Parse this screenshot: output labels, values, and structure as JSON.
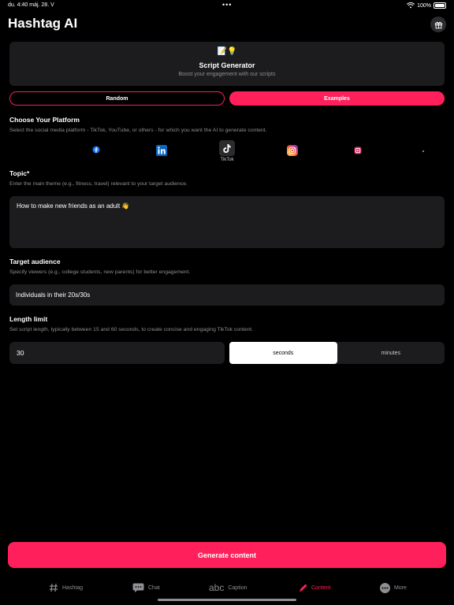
{
  "status_bar": {
    "time_date": "du. 4:40   máj. 28. V",
    "dots": "•••",
    "battery": "100%"
  },
  "app_title": "Hashtag AI",
  "hero": {
    "emoji": "📝💡",
    "title": "Script Generator",
    "subtitle": "Boost your engagement with our scripts"
  },
  "modes": {
    "random": "Random",
    "examples": "Examples"
  },
  "platform_section": {
    "label": "Choose Your Platform",
    "help": "Select the social media platform - TikTok, YouTube, or others - for which you want the AI to generate content.",
    "items": [
      {
        "icon": "facebook-icon",
        "label": ""
      },
      {
        "icon": "linkedin-icon",
        "label": ""
      },
      {
        "icon": "tiktok-icon",
        "label": "TikTok",
        "selected": true
      },
      {
        "icon": "instagram-icon",
        "label": ""
      },
      {
        "icon": "instagram-reels-icon",
        "label": ""
      },
      {
        "icon": "more-platform-icon",
        "label": ""
      }
    ]
  },
  "topic": {
    "label": "Topic*",
    "help": "Enter the main theme (e.g., fitness, travel) relevant to your target audience.",
    "value": "How to make new friends as an adult 👋"
  },
  "audience": {
    "label": "Target audience",
    "help": "Specify viewers (e.g., college students, new parents) for better engagement.",
    "value": "Individuals in their 20s/30s"
  },
  "length": {
    "label": "Length limit",
    "help": "Set script length, typically between 15 and 60 seconds, to create concise and engaging TikTok content.",
    "value": "30",
    "unit_seconds": "seconds",
    "unit_minutes": "minutes",
    "selected_unit": "seconds"
  },
  "generate_label": "Generate content",
  "tabs": {
    "hashtag": "Hashtag",
    "chat": "Chat",
    "caption_glyph": "abc",
    "caption": "Caption",
    "content": "Content",
    "more": "More"
  },
  "colors": {
    "accent": "#ff1f5a",
    "background": "#000000",
    "surface": "#1c1c1e"
  }
}
